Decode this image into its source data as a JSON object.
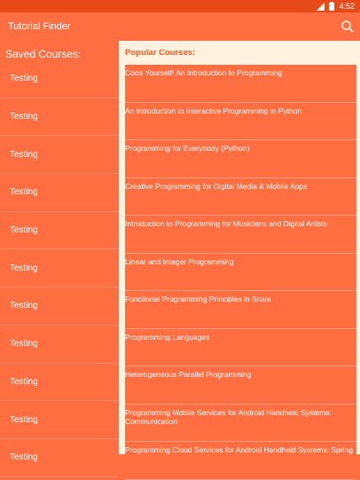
{
  "status_bar": {
    "time": "4:52"
  },
  "app_bar": {
    "title": "Tutorial Finder",
    "search_icon": "search-icon"
  },
  "saved": {
    "heading": "Saved Courses:",
    "items": [
      "Testing",
      "Testing",
      "Testing",
      "Testing",
      "Testing",
      "Testing",
      "Testing",
      "Testing",
      "Testing",
      "Testing",
      "Testing"
    ]
  },
  "popular": {
    "heading": "Popular Courses:",
    "items": [
      "Code Yourself! An Introduction to Programming",
      "An Introduction to Interactive Programming in Python",
      "Programming for Everybody (Python)",
      "Creative Programming for Digital Media & Mobile Apps",
      "Introduction to Programming for Musicians and Digital Artists",
      "Linear and Integer Programming",
      "Functional Programming Principles in Scala",
      "Programming Languages",
      "Heterogeneous Parallel Programming",
      "Programming Mobile Services for Android Handheld Systems: Communication",
      "Programming Cloud Services for Android Handheld Systems: Spring"
    ]
  },
  "colors": {
    "primary": "#ff6e40",
    "status": "#e64a19",
    "panel": "#fff3e0",
    "accent": "#ff5722"
  }
}
